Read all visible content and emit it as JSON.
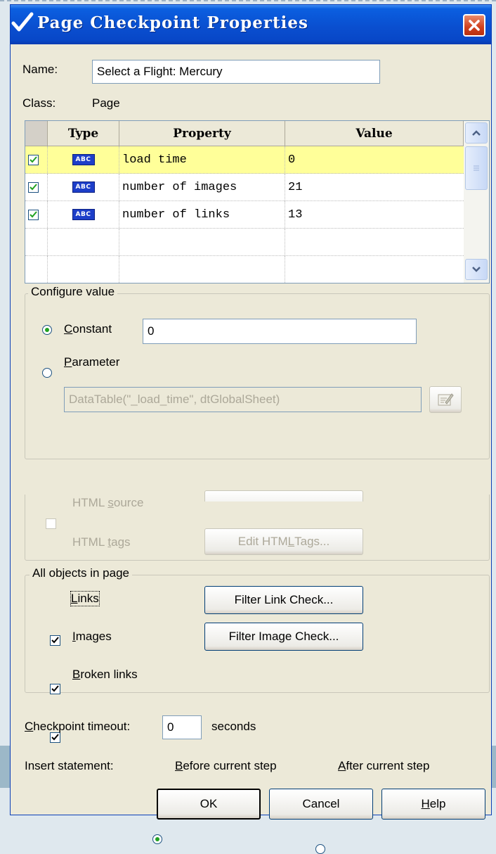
{
  "window": {
    "title": "Page Checkpoint Properties"
  },
  "name_label": "Name:",
  "name_value": "Select a Flight: Mercury",
  "class_label": "Class:",
  "class_value": "Page",
  "grid": {
    "columns": [
      "Type",
      "Property",
      "Value"
    ],
    "rows": [
      {
        "checked": true,
        "type_icon": "ABC",
        "property": "load time",
        "value": "0",
        "selected": true
      },
      {
        "checked": true,
        "type_icon": "ABC",
        "property": "number of images",
        "value": "21",
        "selected": false
      },
      {
        "checked": true,
        "type_icon": "ABC",
        "property": "number of links",
        "value": "13",
        "selected": false
      }
    ],
    "highlight_color": "#ffff99"
  },
  "configure": {
    "title": "Configure value",
    "constant_pre": "",
    "constant_u": "C",
    "constant_post": "onstant",
    "constant_value": "0",
    "parameter_u": "P",
    "parameter_post": "arameter",
    "parameter_value": "DataTable(\"_load_time\", dtGlobalSheet)",
    "selected": "constant"
  },
  "html": {
    "source_pre": "HTML ",
    "source_u": "s",
    "source_post": "ource",
    "tags_pre": "HTML ",
    "tags_u": "t",
    "tags_post": "ags",
    "edit_tags_pre": "Edit HTM",
    "edit_tags_u": "L",
    "edit_tags_post": " Tags..."
  },
  "all_objects": {
    "title": "All objects in page",
    "links_u": "L",
    "links_post": "inks",
    "links_checked": true,
    "images_u": "I",
    "images_post": "mages",
    "images_checked": true,
    "broken_u": "B",
    "broken_post": "roken links",
    "broken_checked": true,
    "filter_links": "Filter Link Check...",
    "filter_images": "Filter Image Check..."
  },
  "timeout": {
    "label_u": "C",
    "label_post": "heckpoint timeout:",
    "value": "0",
    "unit": "seconds"
  },
  "insert": {
    "label": "Insert statement:",
    "before_u": "B",
    "before_post": "efore current step",
    "after_u": "A",
    "after_post": "fter current step",
    "selected": "before"
  },
  "buttons": {
    "ok": "OK",
    "cancel": "Cancel",
    "help_u": "H",
    "help_post": "elp"
  }
}
